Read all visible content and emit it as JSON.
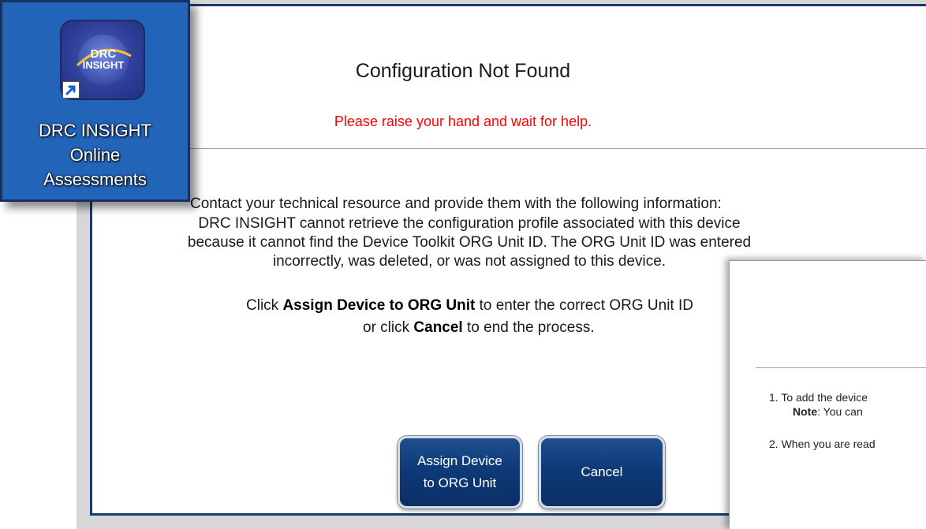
{
  "desktop_icon": {
    "app_name_line1": "DRC INSIGHT",
    "app_name_line2": "Online",
    "app_name_line3": "Assessments",
    "logo_text_top": "DRC",
    "logo_text_bottom": "INSIGHT",
    "icon": "drc-insight-globe-icon",
    "shortcut_icon": "shortcut-arrow-icon"
  },
  "dialog": {
    "title": "Configuration Not Found",
    "subtitle": "Please raise your hand and wait for help.",
    "intro": "Contact your technical resource and provide them with the following information:",
    "body_line1": "DRC INSIGHT cannot retrieve the configuration profile associated with this device",
    "body_line2": "because it cannot find the Device Toolkit ORG Unit ID. The ORG Unit ID was entered",
    "body_line3": "incorrectly, was deleted, or was not assigned to this device.",
    "instr1_prefix": "Click ",
    "instr1_bold": "Assign Device to ORG Unit",
    "instr1_suffix": " to enter the correct ORG Unit ID",
    "instr2_prefix": "or click ",
    "instr2_bold": "Cancel",
    "instr2_suffix": " to end the process.",
    "buttons": {
      "assign": "Assign Device\nto ORG Unit",
      "cancel": "Cancel"
    }
  },
  "secondary_dialog": {
    "step1": "1. To add the device",
    "note_bold": "Note",
    "note_text": ": You can",
    "step2": "2. When you are read"
  },
  "colors": {
    "frame_border": "#1a3a68",
    "subtitle_red": "#ff0000",
    "button_blue": "#0e3a78",
    "icon_card_blue": "#2264b8"
  }
}
